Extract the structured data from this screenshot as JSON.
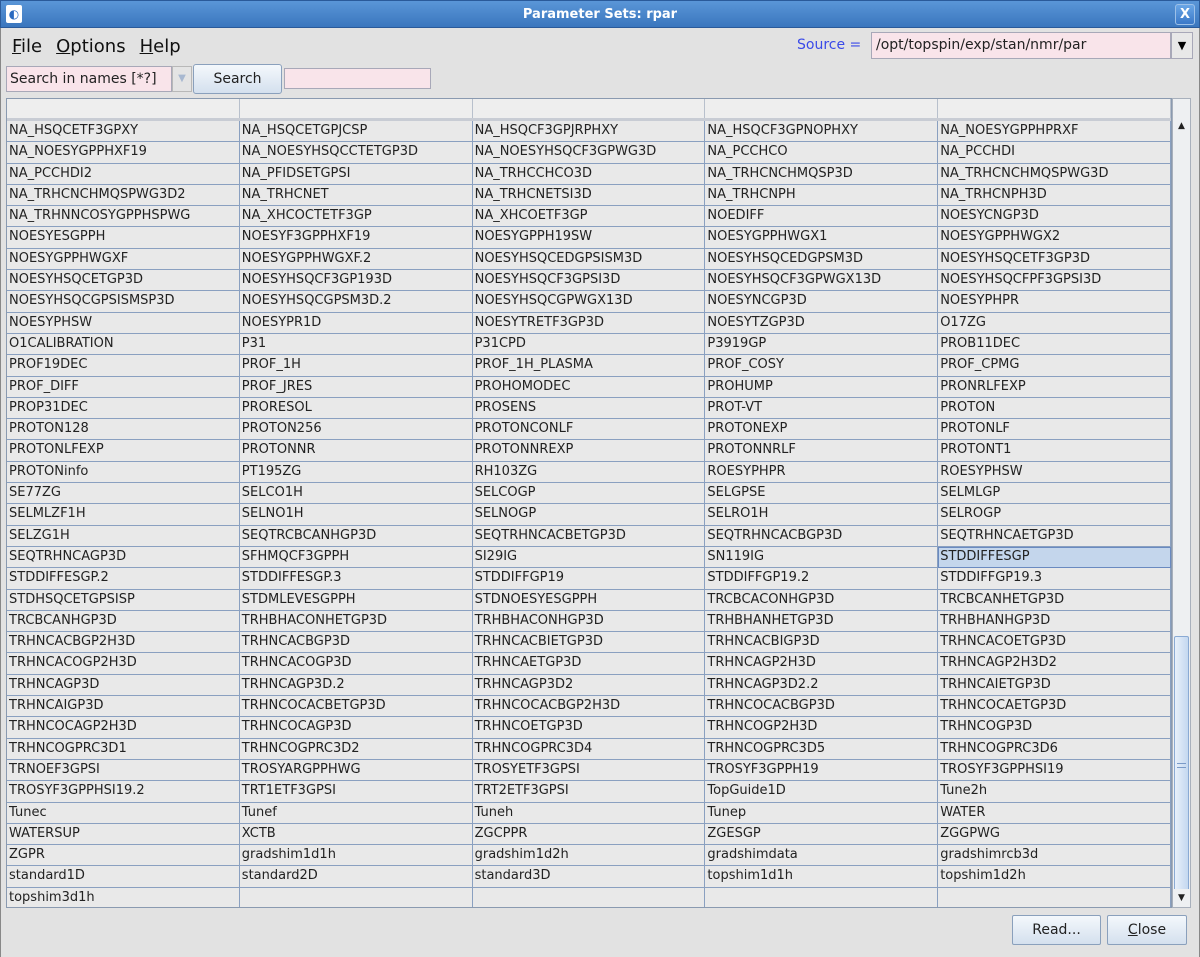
{
  "window": {
    "title": "Parameter Sets: rpar",
    "close_label": "X"
  },
  "menu": {
    "file": "File",
    "options": "Options",
    "help": "Help"
  },
  "source": {
    "label": "Source =",
    "value": "/opt/topspin/exp/stan/nmr/par"
  },
  "search": {
    "mode": "Search in names [*?]",
    "button": "Search",
    "value": ""
  },
  "table": {
    "selected": "STDDIFFESGP",
    "rows": [
      [
        "NA_HSQCETF3GPXY",
        "NA_HSQCETGPJCSP",
        "NA_HSQCF3GPJRPHXY",
        "NA_HSQCF3GPNOPHXY",
        "NA_NOESYGPPHPRXF"
      ],
      [
        "NA_NOESYGPPHXF19",
        "NA_NOESYHSQCCTETGP3D",
        "NA_NOESYHSQCF3GPWG3D",
        "NA_PCCHCO",
        "NA_PCCHDI"
      ],
      [
        "NA_PCCHDI2",
        "NA_PFIDSETGPSI",
        "NA_TRHCCHCO3D",
        "NA_TRHCNCHMQSP3D",
        "NA_TRHCNCHMQSPWG3D"
      ],
      [
        "NA_TRHCNCHMQSPWG3D2",
        "NA_TRHCNET",
        "NA_TRHCNETSI3D",
        "NA_TRHCNPH",
        "NA_TRHCNPH3D"
      ],
      [
        "NA_TRHNNCOSYGPPHSPWG",
        "NA_XHCOCTETF3GP",
        "NA_XHCOETF3GP",
        "NOEDIFF",
        "NOESYCNGP3D"
      ],
      [
        "NOESYESGPPH",
        "NOESYF3GPPHXF19",
        "NOESYGPPH19SW",
        "NOESYGPPHWGX1",
        "NOESYGPPHWGX2"
      ],
      [
        "NOESYGPPHWGXF",
        "NOESYGPPHWGXF.2",
        "NOESYHSQCEDGPSISM3D",
        "NOESYHSQCEDGPSM3D",
        "NOESYHSQCETF3GP3D"
      ],
      [
        "NOESYHSQCETGP3D",
        "NOESYHSQCF3GP193D",
        "NOESYHSQCF3GPSI3D",
        "NOESYHSQCF3GPWGX13D",
        "NOESYHSQCFPF3GPSI3D"
      ],
      [
        "NOESYHSQCGPSISMSP3D",
        "NOESYHSQCGPSM3D.2",
        "NOESYHSQCGPWGX13D",
        "NOESYNCGP3D",
        "NOESYPHPR"
      ],
      [
        "NOESYPHSW",
        "NOESYPR1D",
        "NOESYTRETF3GP3D",
        "NOESYTZGP3D",
        "O17ZG"
      ],
      [
        "O1CALIBRATION",
        "P31",
        "P31CPD",
        "P3919GP",
        "PROB11DEC"
      ],
      [
        "PROF19DEC",
        "PROF_1H",
        "PROF_1H_PLASMA",
        "PROF_COSY",
        "PROF_CPMG"
      ],
      [
        "PROF_DIFF",
        "PROF_JRES",
        "PROHOMODEC",
        "PROHUMP",
        "PRONRLFEXP"
      ],
      [
        "PROP31DEC",
        "PRORESOL",
        "PROSENS",
        "PROT-VT",
        "PROTON"
      ],
      [
        "PROTON128",
        "PROTON256",
        "PROTONCONLF",
        "PROTONEXP",
        "PROTONLF"
      ],
      [
        "PROTONLFEXP",
        "PROTONNR",
        "PROTONNREXP",
        "PROTONNRLF",
        "PROTONT1"
      ],
      [
        "PROTONinfo",
        "PT195ZG",
        "RH103ZG",
        "ROESYPHPR",
        "ROESYPHSW"
      ],
      [
        "SE77ZG",
        "SELCO1H",
        "SELCOGP",
        "SELGPSE",
        "SELMLGP"
      ],
      [
        "SELMLZF1H",
        "SELNO1H",
        "SELNOGP",
        "SELRO1H",
        "SELROGP"
      ],
      [
        "SELZG1H",
        "SEQTRCBCANHGP3D",
        "SEQTRHNCACBETGP3D",
        "SEQTRHNCACBGP3D",
        "SEQTRHNCAETGP3D"
      ],
      [
        "SEQTRHNCAGP3D",
        "SFHMQCF3GPPH",
        "SI29IG",
        "SN119IG",
        "STDDIFFESGP"
      ],
      [
        "STDDIFFESGP.2",
        "STDDIFFESGP.3",
        "STDDIFFGP19",
        "STDDIFFGP19.2",
        "STDDIFFGP19.3"
      ],
      [
        "STDHSQCETGPSISP",
        "STDMLEVESGPPH",
        "STDNOESYESGPPH",
        "TRCBCACONHGP3D",
        "TRCBCANHETGP3D"
      ],
      [
        "TRCBCANHGP3D",
        "TRHBHACONHETGP3D",
        "TRHBHACONHGP3D",
        "TRHBHANHETGP3D",
        "TRHBHANHGP3D"
      ],
      [
        "TRHNCACBGP2H3D",
        "TRHNCACBGP3D",
        "TRHNCACBIETGP3D",
        "TRHNCACBIGP3D",
        "TRHNCACOETGP3D"
      ],
      [
        "TRHNCACOGP2H3D",
        "TRHNCACOGP3D",
        "TRHNCAETGP3D",
        "TRHNCAGP2H3D",
        "TRHNCAGP2H3D2"
      ],
      [
        "TRHNCAGP3D",
        "TRHNCAGP3D.2",
        "TRHNCAGP3D2",
        "TRHNCAGP3D2.2",
        "TRHNCAIETGP3D"
      ],
      [
        "TRHNCAIGP3D",
        "TRHNCOCACBETGP3D",
        "TRHNCOCACBGP2H3D",
        "TRHNCOCACBGP3D",
        "TRHNCOCAETGP3D"
      ],
      [
        "TRHNCOCAGP2H3D",
        "TRHNCOCAGP3D",
        "TRHNCOETGP3D",
        "TRHNCOGP2H3D",
        "TRHNCOGP3D"
      ],
      [
        "TRHNCOGPRC3D1",
        "TRHNCOGPRC3D2",
        "TRHNCOGPRC3D4",
        "TRHNCOGPRC3D5",
        "TRHNCOGPRC3D6"
      ],
      [
        "TRNOEF3GPSI",
        "TROSYARGPPHWG",
        "TROSYETF3GPSI",
        "TROSYF3GPPH19",
        "TROSYF3GPPHSI19"
      ],
      [
        "TROSYF3GPPHSI19.2",
        "TRT1ETF3GPSI",
        "TRT2ETF3GPSI",
        "TopGuide1D",
        "Tune2h"
      ],
      [
        "Tunec",
        "Tunef",
        "Tuneh",
        "Tunep",
        "WATER"
      ],
      [
        "WATERSUP",
        "XCTB",
        "ZGCPPR",
        "ZGESGP",
        "ZGGPWG"
      ],
      [
        "ZGPR",
        "gradshim1d1h",
        "gradshim1d2h",
        "gradshimdata",
        "gradshimrcb3d"
      ],
      [
        "standard1D",
        "standard2D",
        "standard3D",
        "topshim1d1h",
        "topshim1d2h"
      ],
      [
        "topshim3d1h",
        "",
        "",
        "",
        ""
      ]
    ]
  },
  "scrollbar": {
    "position_fraction": 0.68,
    "visible_fraction": 0.33
  },
  "buttons": {
    "read": "Read...",
    "close": "Close"
  }
}
